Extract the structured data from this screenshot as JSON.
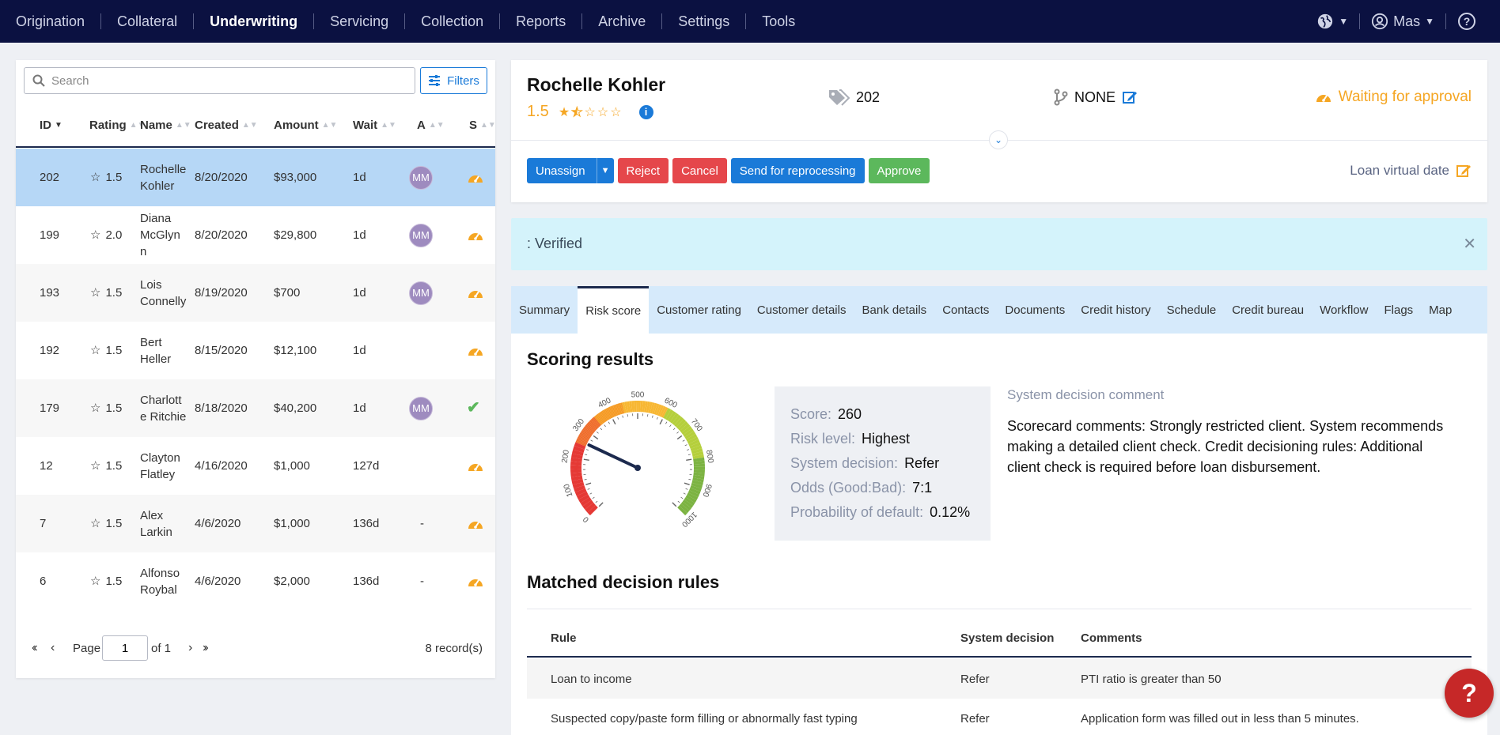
{
  "nav": {
    "items": [
      {
        "label": "Origination",
        "active": false
      },
      {
        "label": "Collateral",
        "active": false
      },
      {
        "label": "Underwriting",
        "active": true
      },
      {
        "label": "Servicing",
        "active": false
      },
      {
        "label": "Collection",
        "active": false
      },
      {
        "label": "Reports",
        "active": false
      },
      {
        "label": "Archive",
        "active": false
      },
      {
        "label": "Settings",
        "active": false
      },
      {
        "label": "Tools",
        "active": false
      }
    ],
    "user_label": "Mas",
    "icons": [
      "globe-icon",
      "user-icon",
      "help-circle-icon"
    ]
  },
  "list": {
    "search_placeholder": "Search",
    "filters_label": "Filters",
    "columns": [
      "ID",
      "Rating",
      "Name",
      "Created",
      "Amount",
      "Wait",
      "A",
      "S"
    ],
    "rows": [
      {
        "id": "202",
        "rating": "1.5",
        "name1": "Rochelle",
        "name2": "Kohler",
        "created": "8/20/2020",
        "amount": "$93,000",
        "wait": "1d",
        "assignee": "MM",
        "status": "gauge"
      },
      {
        "id": "199",
        "rating": "2.0",
        "name1": "Diana",
        "name2": "McGlyn",
        "name3": "n",
        "created": "8/20/2020",
        "amount": "$29,800",
        "wait": "1d",
        "assignee": "MM",
        "status": "gauge"
      },
      {
        "id": "193",
        "rating": "1.5",
        "name1": "Lois",
        "name2": "Connelly",
        "created": "8/19/2020",
        "amount": "$700",
        "wait": "1d",
        "assignee": "MM",
        "status": "gauge"
      },
      {
        "id": "192",
        "rating": "1.5",
        "name1": "Bert",
        "name2": "Heller",
        "created": "8/15/2020",
        "amount": "$12,100",
        "wait": "1d",
        "assignee": "",
        "status": "gauge"
      },
      {
        "id": "179",
        "rating": "1.5",
        "name1": "Charlott",
        "name2": "e Ritchie",
        "created": "8/18/2020",
        "amount": "$40,200",
        "wait": "1d",
        "assignee": "MM",
        "status": "check"
      },
      {
        "id": "12",
        "rating": "1.5",
        "name1": "Clayton",
        "name2": "Flatley",
        "created": "4/16/2020",
        "amount": "$1,000",
        "wait": "127d",
        "assignee": "",
        "status": "gauge"
      },
      {
        "id": "7",
        "rating": "1.5",
        "name1": "Alex",
        "name2": "Larkin",
        "created": "4/6/2020",
        "amount": "$1,000",
        "wait": "136d",
        "assignee": "-",
        "status": "gauge"
      },
      {
        "id": "6",
        "rating": "1.5",
        "name1": "Alfonso",
        "name2": "Roybal",
        "created": "4/6/2020",
        "amount": "$2,000",
        "wait": "136d",
        "assignee": "-",
        "status": "gauge"
      }
    ],
    "pager": {
      "page_label": "Page",
      "page_value": "1",
      "of_label": "of 1",
      "records": "8 record(s)"
    }
  },
  "detail": {
    "name": "Rochelle Kohler",
    "rating": "1.5",
    "rating_stars": 1.5,
    "tag_value": "202",
    "branch_value": "NONE",
    "status": "Waiting for approval",
    "buttons": {
      "unassign": "Unassign",
      "reject": "Reject",
      "cancel": "Cancel",
      "reprocess": "Send for reprocessing",
      "approve": "Approve"
    },
    "loan_virtual_date": "Loan virtual date",
    "alert": ": Verified"
  },
  "tabs": [
    "Summary",
    "Risk score",
    "Customer rating",
    "Customer details",
    "Bank details",
    "Contacts",
    "Documents",
    "Credit history",
    "Schedule",
    "Credit bureau",
    "Workflow",
    "Flags",
    "Map"
  ],
  "active_tab": "Risk score",
  "scoring": {
    "title": "Scoring results",
    "gauge": {
      "min": 0,
      "max": 1000,
      "value": 260,
      "ticks": [
        "0",
        "100",
        "200",
        "300",
        "400",
        "500",
        "600",
        "700",
        "800",
        "900",
        "1000"
      ]
    },
    "score_label": "Score:",
    "score": "260",
    "risk_label": "Risk level:",
    "risk": "Highest",
    "decision_label": "System decision:",
    "decision": "Refer",
    "odds_label": "Odds (Good:Bad):",
    "odds": "7:1",
    "pd_label": "Probability of default:",
    "pd": "0.12%",
    "comment_title": "System decision comment",
    "comment": "Scorecard comments: Strongly restricted client. System recommends making a detailed client check. Credit decisioning rules: Additional client check is required before loan disbursement."
  },
  "rules": {
    "title": "Matched decision rules",
    "columns": [
      "Rule",
      "System decision",
      "Comments"
    ],
    "rows": [
      {
        "rule": "Loan to income",
        "decision": "Refer",
        "comment": "PTI ratio is greater than 50"
      },
      {
        "rule": "Suspected copy/paste form filling or abnormally fast typing",
        "decision": "Refer",
        "comment": "Application form was filled out in less than 5 minutes."
      }
    ]
  },
  "colors": {
    "nav_bg": "#0b1141",
    "accent": "#1a7ad8",
    "warning": "#f5a623",
    "danger": "#e5474b",
    "success": "#5cb85c",
    "selected_row": "#b6d7f6"
  }
}
